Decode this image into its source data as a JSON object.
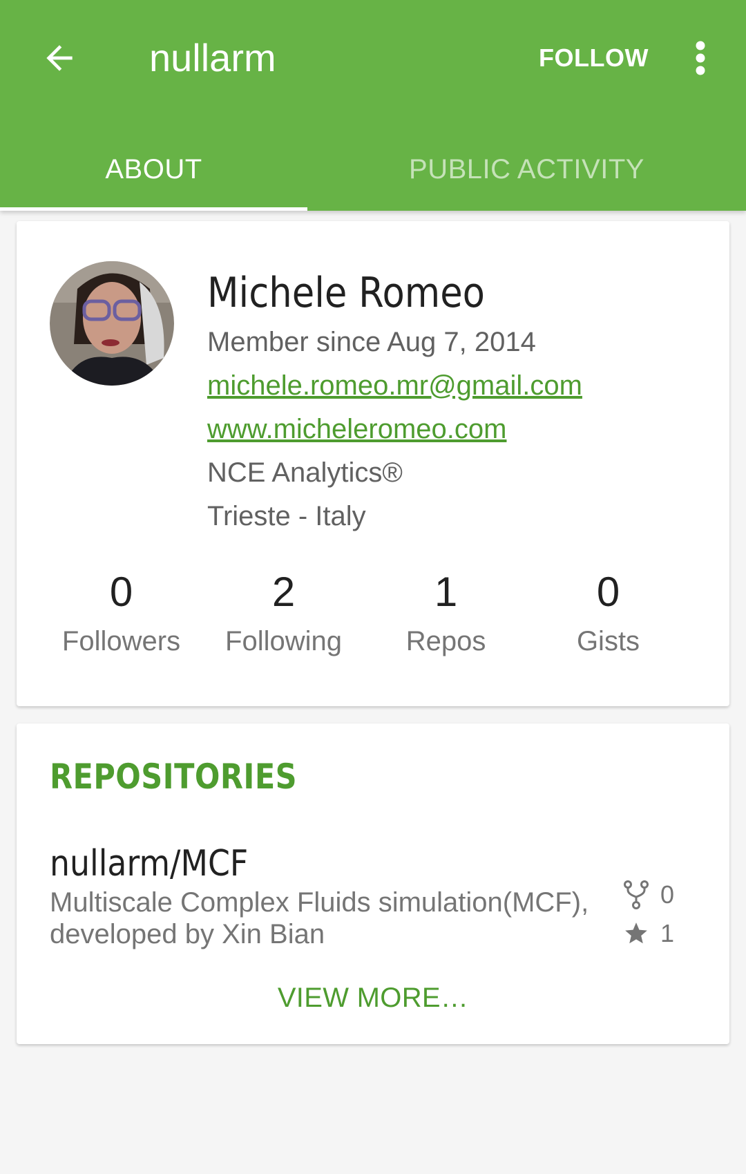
{
  "appbar": {
    "title": "nullarm",
    "follow_label": "FOLLOW",
    "color": "#67b346"
  },
  "tabs": [
    {
      "label": "ABOUT",
      "active": true
    },
    {
      "label": "PUBLIC ACTIVITY",
      "active": false
    }
  ],
  "profile": {
    "name": "Michele Romeo",
    "member_since": "Member since Aug 7, 2014",
    "email": "michele.romeo.mr@gmail.com",
    "website": "www.micheleromeo.com",
    "company": "NCE Analytics®",
    "location": "Trieste - Italy",
    "stats": [
      {
        "value": "0",
        "label": "Followers"
      },
      {
        "value": "2",
        "label": "Following"
      },
      {
        "value": "1",
        "label": "Repos"
      },
      {
        "value": "0",
        "label": "Gists"
      }
    ]
  },
  "repositories": {
    "header": "REPOSITORIES",
    "items": [
      {
        "name": "nullarm/MCF",
        "description": "Multiscale Complex Fluids simulation(MCF), developed by Xin Bian",
        "forks": "0",
        "stars": "1"
      }
    ],
    "view_more_label": "VIEW MORE…"
  },
  "icons": {
    "back": "arrow-back-icon",
    "more": "more-vert-icon",
    "fork": "fork-icon",
    "star": "star-icon"
  }
}
